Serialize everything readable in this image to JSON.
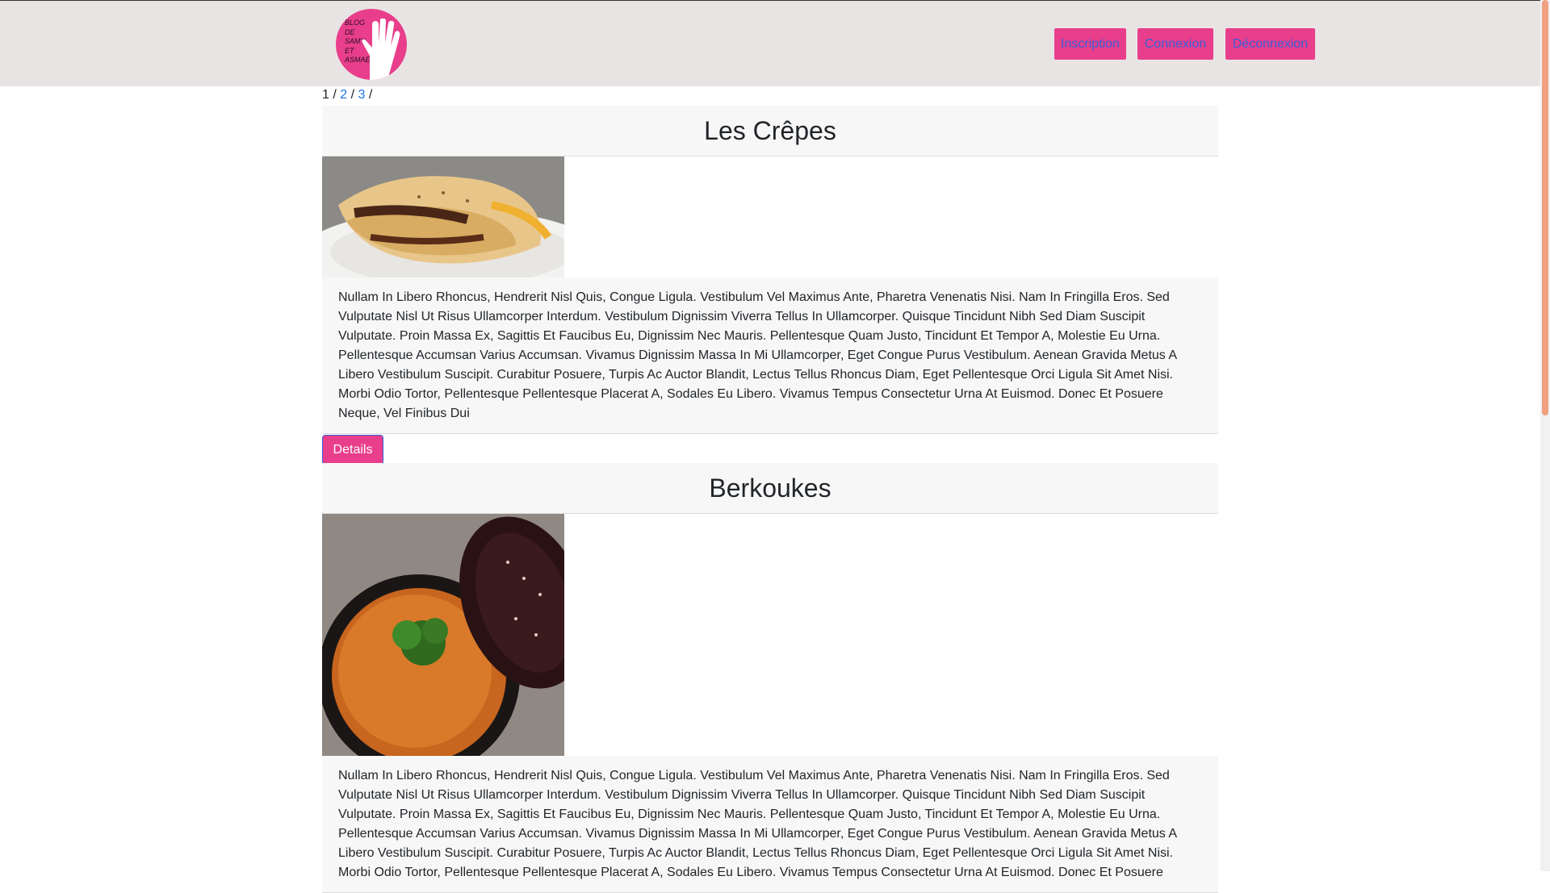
{
  "logo": {
    "text": "BLOG\nDE\nSAMY\nET\nASMAE"
  },
  "nav": {
    "inscription": "Inscription",
    "connexion": "Connexion",
    "deconnexion": "Déconnexion"
  },
  "pagination": {
    "current": "1",
    "sep": "/",
    "pages": [
      "2",
      "3"
    ]
  },
  "posts": [
    {
      "title": "Les Crêpes",
      "body": "Nullam In Libero Rhoncus, Hendrerit Nisl Quis, Congue Ligula. Vestibulum Vel Maximus Ante, Pharetra Venenatis Nisi. Nam In Fringilla Eros. Sed Vulputate Nisl Ut Risus Ullamcorper Interdum. Vestibulum Dignissim Viverra Tellus In Ullamcorper. Quisque Tincidunt Nibh Sed Diam Suscipit Vulputate. Proin Massa Ex, Sagittis Et Faucibus Eu, Dignissim Nec Mauris. Pellentesque Quam Justo, Tincidunt Et Tempor A, Molestie Eu Urna. Pellentesque Accumsan Varius Accumsan. Vivamus Dignissim Massa In Mi Ullamcorper, Eget Congue Purus Vestibulum. Aenean Gravida Metus A Libero Vestibulum Suscipit. Curabitur Posuere, Turpis Ac Auctor Blandit, Lectus Tellus Rhoncus Diam, Eget Pellentesque Orci Ligula Sit Amet Nisi. Morbi Odio Tortor, Pellentesque Pellentesque Placerat A, Sodales Eu Libero. Vivamus Tempus Consectetur Urna At Euismod. Donec Et Posuere Neque, Vel Finibus Dui",
      "details": "Details"
    },
    {
      "title": "Berkoukes",
      "body": "Nullam In Libero Rhoncus, Hendrerit Nisl Quis, Congue Ligula. Vestibulum Vel Maximus Ante, Pharetra Venenatis Nisi. Nam In Fringilla Eros. Sed Vulputate Nisl Ut Risus Ullamcorper Interdum. Vestibulum Dignissim Viverra Tellus In Ullamcorper. Quisque Tincidunt Nibh Sed Diam Suscipit Vulputate. Proin Massa Ex, Sagittis Et Faucibus Eu, Dignissim Nec Mauris. Pellentesque Quam Justo, Tincidunt Et Tempor A, Molestie Eu Urna. Pellentesque Accumsan Varius Accumsan. Vivamus Dignissim Massa In Mi Ullamcorper, Eget Congue Purus Vestibulum. Aenean Gravida Metus A Libero Vestibulum Suscipit. Curabitur Posuere, Turpis Ac Auctor Blandit, Lectus Tellus Rhoncus Diam, Eget Pellentesque Orci Ligula Sit Amet Nisi. Morbi Odio Tortor, Pellentesque Pellentesque Placerat A, Sodales Eu Libero. Vivamus Tempus Consectetur Urna At Euismod. Donec Et Posuere"
    }
  ],
  "colors": {
    "accent": "#e83e8c",
    "header_bg": "#e9e4e4",
    "link": "#1a73e8"
  }
}
